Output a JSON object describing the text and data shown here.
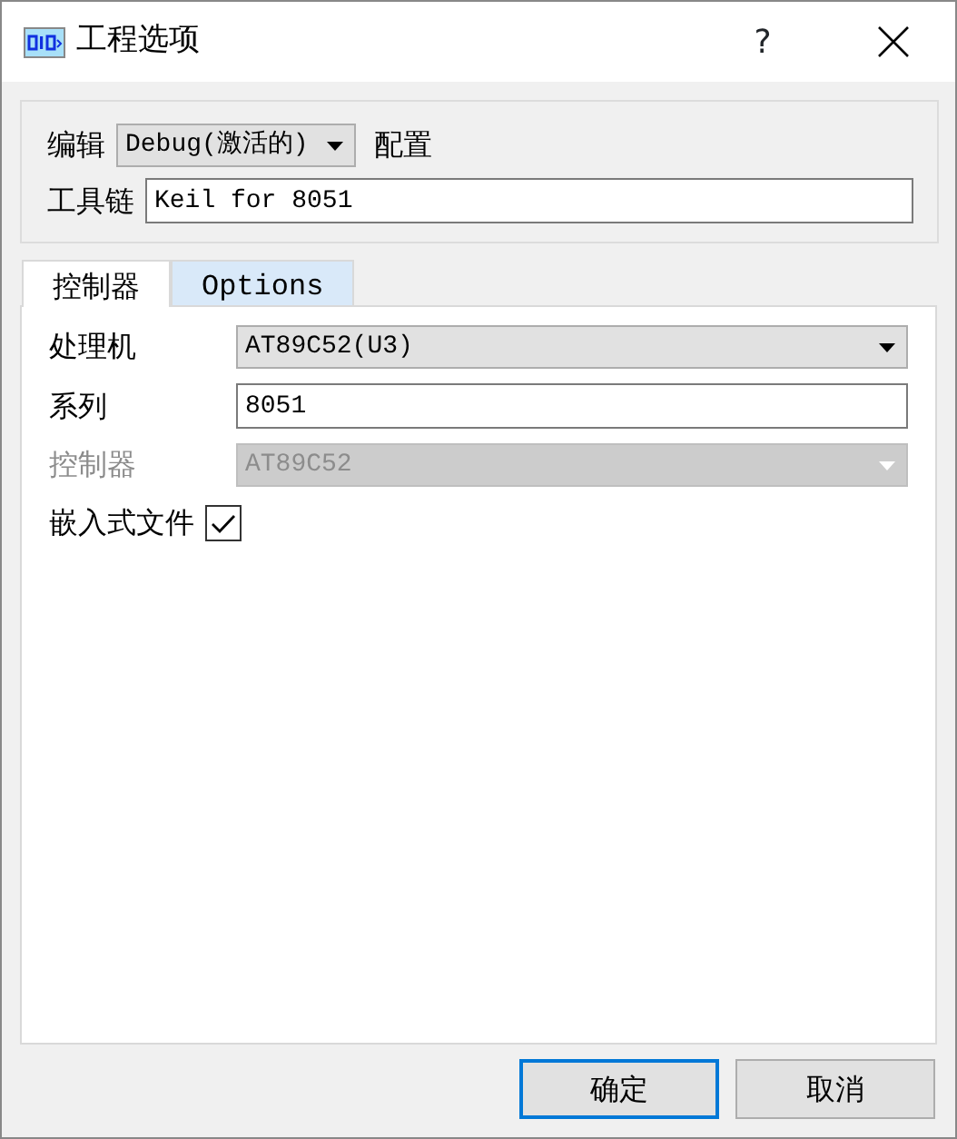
{
  "window": {
    "title": "工程选项",
    "help": "?"
  },
  "config": {
    "label": "编辑",
    "value": "Debug(激活的)",
    "suffix": "配置"
  },
  "toolchain": {
    "label": "工具链",
    "value": "Keil for 8051"
  },
  "tabs": [
    {
      "label": "控制器",
      "selected": true
    },
    {
      "label": "Options",
      "selected": false
    }
  ],
  "fields": [
    {
      "kind": "dropdown",
      "label": "处理机",
      "value": "AT89C52(U3)",
      "disabled": false
    },
    {
      "kind": "text",
      "label": "系列",
      "value": "8051",
      "disabled": false
    },
    {
      "kind": "dropdown",
      "label": "控制器",
      "value": "AT89C52",
      "disabled": true
    },
    {
      "kind": "checkbox",
      "label": "嵌入式文件",
      "checked": true
    }
  ],
  "buttons": [
    {
      "label": "确定",
      "default": true
    },
    {
      "label": "取消",
      "default": false
    }
  ]
}
